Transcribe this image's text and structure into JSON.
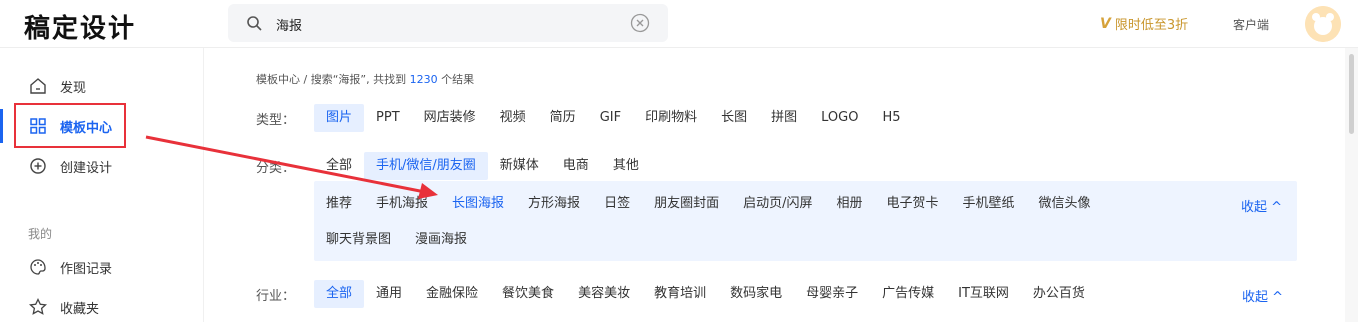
{
  "app": {
    "logo": "稿定设计"
  },
  "search": {
    "value": "海报"
  },
  "header": {
    "vip_label": "限时低至3折",
    "client_label": "客户端"
  },
  "sidebar": {
    "items": [
      {
        "label": "发现",
        "icon": "home-icon"
      },
      {
        "label": "模板中心",
        "icon": "grid-icon",
        "active": true
      },
      {
        "label": "创建设计",
        "icon": "plus-circle-icon"
      }
    ],
    "section_title": "我的",
    "my_items": [
      {
        "label": "作图记录",
        "icon": "palette-icon"
      },
      {
        "label": "收藏夹",
        "icon": "star-icon"
      }
    ]
  },
  "breadcrumb": {
    "root": "模板中心",
    "sep": "/",
    "query": "搜索“海报”,",
    "found": "共找到",
    "count": "1230",
    "suffix": "个结果"
  },
  "filters": {
    "type": {
      "label": "类型：",
      "options": [
        "图片",
        "PPT",
        "网店装修",
        "视频",
        "简历",
        "GIF",
        "印刷物料",
        "长图",
        "拼图",
        "LOGO",
        "H5"
      ],
      "selected": "图片"
    },
    "category": {
      "label": "分类：",
      "options": [
        "全部",
        "手机/微信/朋友圈",
        "新媒体",
        "电商",
        "其他"
      ],
      "selected": "手机/微信/朋友圈"
    },
    "subcategory": {
      "row1": [
        "推荐",
        "手机海报",
        "长图海报",
        "方形海报",
        "日签",
        "朋友圈封面",
        "启动页/闪屏",
        "相册",
        "电子贺卡",
        "手机壁纸",
        "微信头像"
      ],
      "row2": [
        "聊天背景图",
        "漫画海报"
      ],
      "selected": "长图海报",
      "collapse": "收起 ^"
    },
    "industry": {
      "label": "行业：",
      "options": [
        "全部",
        "通用",
        "金融保险",
        "餐饮美食",
        "美容美妆",
        "教育培训",
        "数码家电",
        "母婴亲子",
        "广告传媒",
        "IT互联网",
        "办公百货"
      ],
      "selected": "全部",
      "collapse": "收起 ^"
    }
  },
  "colors": {
    "accent": "#1b64f0",
    "annotation": "#e8313a",
    "vip": "#c9962c"
  }
}
